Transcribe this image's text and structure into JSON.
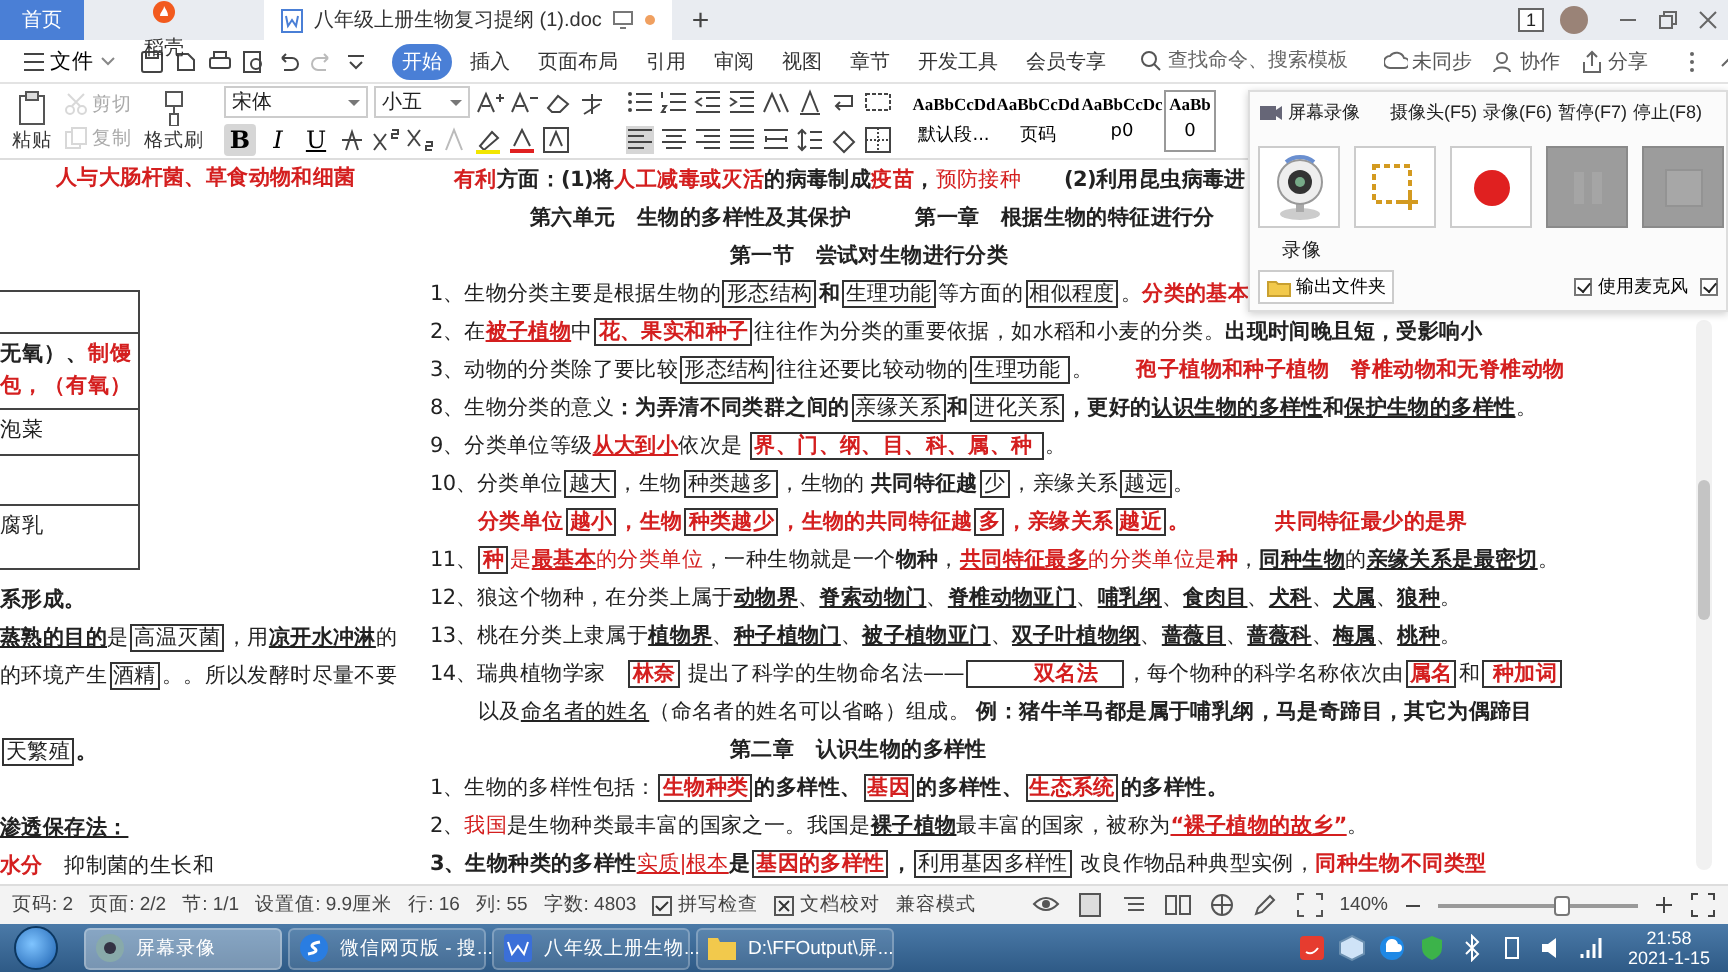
{
  "doc_tabs": [
    {
      "label": "首页",
      "kind": "home",
      "selected": false
    },
    {
      "label": "稻壳",
      "kind": "app",
      "selected": false
    },
    {
      "label": "八年级上册生物复习提纲 (1).doc",
      "kind": "doc",
      "selected": true
    }
  ],
  "new_tab_label": "+",
  "notification_badge": "1",
  "menu": {
    "file_label": "文件",
    "tabs": [
      {
        "label": "开始",
        "selected": true
      },
      {
        "label": "插入",
        "selected": false
      },
      {
        "label": "页面布局",
        "selected": false
      },
      {
        "label": "引用",
        "selected": false
      },
      {
        "label": "审阅",
        "selected": false
      },
      {
        "label": "视图",
        "selected": false
      },
      {
        "label": "章节",
        "selected": false
      },
      {
        "label": "开发工具",
        "selected": false
      },
      {
        "label": "会员专享",
        "selected": false
      }
    ],
    "search": {
      "placeholder": "查找命令、搜索模板"
    },
    "actions": [
      "未同步",
      "协作",
      "分享"
    ]
  },
  "toolbar": {
    "clipboard": [
      {
        "label": "粘贴",
        "kind": "paste",
        "disabled": false
      },
      {
        "label": "剪切",
        "kind": "cut",
        "disabled": true
      },
      {
        "label": "复制",
        "kind": "copy",
        "disabled": true
      },
      {
        "label": "格式刷",
        "kind": "painter",
        "disabled": false
      }
    ],
    "font": "宋体",
    "font_size": "小五",
    "font_buttons": [
      {
        "label": "B",
        "kind": "bold",
        "selected": true
      },
      {
        "label": "I",
        "kind": "italic",
        "selected": false
      },
      {
        "label": "U",
        "kind": "underline",
        "selected": false
      }
    ],
    "styles": [
      {
        "preview": "AaBbCcDd",
        "name": "默认段...",
        "selected": false
      },
      {
        "preview": "AaBbCcDd",
        "name": "页码",
        "selected": false
      },
      {
        "preview": "AaBbCcDc",
        "name": "p0",
        "selected": false
      },
      {
        "preview": "AaBb",
        "name": "0",
        "selected": true
      }
    ]
  },
  "recorder": {
    "title": "屏幕录像",
    "hotkeys": [
      "摄像头(F5)",
      "录像(F6)",
      "暂停(F7)",
      "停止(F8)"
    ],
    "tools": [
      {
        "kind": "webcam",
        "disabled": false
      },
      {
        "kind": "region",
        "disabled": false
      },
      {
        "kind": "record",
        "disabled": false
      },
      {
        "kind": "pause",
        "disabled": true
      },
      {
        "kind": "stop",
        "disabled": true
      }
    ],
    "mode_label": "录像",
    "folder_button": "输出文件夹",
    "checkboxes": [
      {
        "label": "使用麦克风",
        "checked": true
      },
      {
        "checked": true
      }
    ]
  },
  "document": {
    "left_page": {
      "title": [
        {
          "text": "人与大肠杆菌、草食动物和细菌",
          "kind": "redbold"
        }
      ],
      "table": {
        "rows": [
          {
            "kind": "empty"
          },
          {
            "kind": "text",
            "lines": [
              [
                {
                  "text": "无氧）、",
                  "kind": "bold"
                },
                {
                  "text": "制馒",
                  "kind": "redbold"
                }
              ],
              [
                {
                  "text": "包，（有氧）",
                  "kind": "redbold"
                }
              ]
            ]
          },
          {
            "kind": "text",
            "lines": [
              [
                {
                  "text": "泡菜",
                  "kind": "plain"
                }
              ]
            ]
          },
          {
            "kind": "empty"
          },
          {
            "kind": "text",
            "lines": [
              [
                {
                  "text": "腐乳",
                  "kind": "plain"
                }
              ]
            ]
          }
        ]
      },
      "lines": [
        {
          "kind": "line",
          "segments": [
            {
              "text": "系形成。",
              "kind": "bold"
            }
          ]
        },
        {
          "kind": "line",
          "segments": [
            {
              "text": "蒸熟的目的",
              "kind": "boldunder"
            },
            {
              "text": "是",
              "kind": "plain"
            },
            {
              "text": "高温灭菌",
              "kind": "box"
            },
            {
              "text": "，用",
              "kind": "plain"
            },
            {
              "text": "凉开水冲淋",
              "kind": "boldunder"
            },
            {
              "text": "的",
              "kind": "plain"
            }
          ]
        },
        {
          "kind": "line",
          "segments": [
            {
              "text": "的环境产生",
              "kind": "plain"
            },
            {
              "text": "酒精",
              "kind": "box"
            },
            {
              "text": "。。所以发酵时尽量不要",
              "kind": "plain"
            }
          ]
        },
        {
          "kind": "para",
          "segments": [
            {
              "text": "天繁殖",
              "kind": "box"
            },
            {
              "text": "。",
              "kind": "bold"
            }
          ]
        },
        {
          "kind": "para",
          "segments": [
            {
              "text": "渗透保存法：",
              "kind": "boldunder"
            }
          ]
        },
        {
          "kind": "line",
          "segments": [
            {
              "text": "水分",
              "kind": "redbold"
            },
            {
              "text": "　抑制菌的生长和",
              "kind": "plain"
            }
          ]
        }
      ]
    },
    "right_page": {
      "lines": [
        {
          "kind": "note",
          "segments": [
            {
              "text": "有利",
              "kind": "redbold"
            },
            {
              "text": "方面：(1)将",
              "kind": "bold"
            },
            {
              "text": "人工减毒或灭活",
              "kind": "redbold"
            },
            {
              "text": "的病毒制成",
              "kind": "bold"
            },
            {
              "text": "疫苗",
              "kind": "redbold"
            },
            {
              "text": "，",
              "kind": "bold"
            },
            {
              "text": "预防接种",
              "kind": "red"
            },
            {
              "text": "　　(2)利用昆虫病毒进",
              "kind": "bold"
            }
          ]
        },
        {
          "kind": "title",
          "segments": [
            {
              "text": "第六单元　生物的多样性及其保护　　　第一章　根据生物的特征进行分",
              "kind": "bold"
            }
          ]
        },
        {
          "kind": "heading",
          "segments": [
            {
              "text": "第一节　尝试对生物进行分类",
              "kind": "bold"
            }
          ]
        },
        {
          "kind": "item",
          "segments": [
            {
              "text": "1、生物分类主要是根据生物的",
              "kind": "plain"
            },
            {
              "text": "形态结构",
              "kind": "box"
            },
            {
              "text": "和",
              "kind": "bold"
            },
            {
              "text": "生理功能",
              "kind": "box"
            },
            {
              "text": "等方面的",
              "kind": "plain"
            },
            {
              "text": "相似程度",
              "kind": "box"
            },
            {
              "text": "。",
              "kind": "plain"
            },
            {
              "text": "分类的基本",
              "kind": "redbold"
            }
          ]
        },
        {
          "kind": "item",
          "segments": [
            {
              "text": "2、在",
              "kind": "plain"
            },
            {
              "text": "被子植物",
              "kind": "redboldunder"
            },
            {
              "text": "中",
              "kind": "plain"
            },
            {
              "text": "花、果实和种子",
              "kind": "redbox"
            },
            {
              "text": "往往作为分类的重要依据，如水稻和小麦的分类。",
              "kind": "plain"
            },
            {
              "text": "出现时间晚且短，受影响小",
              "kind": "bold"
            }
          ]
        },
        {
          "kind": "item",
          "segments": [
            {
              "text": "3、动物的分类除了要比较",
              "kind": "plain"
            },
            {
              "text": "形态结构",
              "kind": "box"
            },
            {
              "text": "往往还要比较动物的",
              "kind": "plain"
            },
            {
              "text": "生理功能 ",
              "kind": "box"
            },
            {
              "text": "。　　",
              "kind": "plain"
            },
            {
              "text": "孢子植物和种子植物　脊椎动物和无脊椎动物",
              "kind": "redbold"
            }
          ]
        },
        {
          "kind": "item",
          "segments": [
            {
              "text": "8、生物分类的意义",
              "kind": "plain"
            },
            {
              "text": "：为弄清不同类群之间的",
              "kind": "bold"
            },
            {
              "text": "亲缘关系",
              "kind": "box"
            },
            {
              "text": "和",
              "kind": "bold"
            },
            {
              "text": "进化关系",
              "kind": "box"
            },
            {
              "text": "，更好的",
              "kind": "bold"
            },
            {
              "text": "认识生物的多样性",
              "kind": "boldunder"
            },
            {
              "text": "和",
              "kind": "bold"
            },
            {
              "text": "保护生物的多样性",
              "kind": "boldunder"
            },
            {
              "text": "。",
              "kind": "plain"
            }
          ]
        },
        {
          "kind": "item",
          "segments": [
            {
              "text": "9、分类单位等级",
              "kind": "plain"
            },
            {
              "text": "从大到小",
              "kind": "redboldunder"
            },
            {
              "text": "依次是 ",
              "kind": "plain"
            },
            {
              "text": "界、门、纲、目、科、属、种 ",
              "kind": "redbox"
            },
            {
              "text": "。",
              "kind": "plain"
            }
          ]
        },
        {
          "kind": "item",
          "segments": [
            {
              "text": "10、分类单位",
              "kind": "plain"
            },
            {
              "text": "越大",
              "kind": "box"
            },
            {
              "text": "，生物",
              "kind": "plain"
            },
            {
              "text": "种类越多",
              "kind": "box"
            },
            {
              "text": "，生物的 ",
              "kind": "plain"
            },
            {
              "text": "共同特征越",
              "kind": "bold"
            },
            {
              "text": "少",
              "kind": "box"
            },
            {
              "text": "，亲缘关系",
              "kind": "plain"
            },
            {
              "text": "越远",
              "kind": "box"
            },
            {
              "text": "。",
              "kind": "plain"
            }
          ]
        },
        {
          "kind": "indent",
          "segments": [
            {
              "text": "分类单位",
              "kind": "redbold"
            },
            {
              "text": "越小",
              "kind": "redbox"
            },
            {
              "text": "，生物",
              "kind": "redbold"
            },
            {
              "text": "种类越少",
              "kind": "redbox"
            },
            {
              "text": "，生物的共同特征越",
              "kind": "redbold"
            },
            {
              "text": "多",
              "kind": "redbox"
            },
            {
              "text": "，亲缘关系",
              "kind": "redbold"
            },
            {
              "text": "越近",
              "kind": "redbox"
            },
            {
              "text": "。　　　　共同特征最少的是界",
              "kind": "redbold"
            }
          ]
        },
        {
          "kind": "item",
          "segments": [
            {
              "text": "11、",
              "kind": "plain"
            },
            {
              "text": "种",
              "kind": "redbox"
            },
            {
              "text": "是",
              "kind": "red"
            },
            {
              "text": "最基本",
              "kind": "redboldunder"
            },
            {
              "text": "的分类单位",
              "kind": "red"
            },
            {
              "text": "，一种生物就是一个",
              "kind": "plain"
            },
            {
              "text": "物种",
              "kind": "bold"
            },
            {
              "text": "，",
              "kind": "plain"
            },
            {
              "text": "共同特征最多",
              "kind": "redboldunder"
            },
            {
              "text": "的分类单位是",
              "kind": "red"
            },
            {
              "text": "种",
              "kind": "redbold"
            },
            {
              "text": "，",
              "kind": "plain"
            },
            {
              "text": "同种生物",
              "kind": "boldunder"
            },
            {
              "text": "的",
              "kind": "plain"
            },
            {
              "text": "亲缘关系是最密切",
              "kind": "boldunder"
            },
            {
              "text": "。",
              "kind": "plain"
            }
          ]
        },
        {
          "kind": "item",
          "segments": [
            {
              "text": "12、狼这个物种，在分类上属于",
              "kind": "plain"
            },
            {
              "text": "动物界",
              "kind": "boldunder"
            },
            {
              "text": "、",
              "kind": "plain"
            },
            {
              "text": "脊索动物门",
              "kind": "boldunder"
            },
            {
              "text": "、",
              "kind": "plain"
            },
            {
              "text": "脊椎动物亚门",
              "kind": "boldunder"
            },
            {
              "text": "、",
              "kind": "plain"
            },
            {
              "text": "哺乳纲",
              "kind": "boldunder"
            },
            {
              "text": "、",
              "kind": "plain"
            },
            {
              "text": "食肉目",
              "kind": "boldunder"
            },
            {
              "text": "、",
              "kind": "plain"
            },
            {
              "text": "犬科",
              "kind": "boldunder"
            },
            {
              "text": "、",
              "kind": "plain"
            },
            {
              "text": "犬属",
              "kind": "boldunder"
            },
            {
              "text": "、",
              "kind": "plain"
            },
            {
              "text": "狼种",
              "kind": "boldunder"
            },
            {
              "text": "。",
              "kind": "plain"
            }
          ]
        },
        {
          "kind": "item",
          "segments": [
            {
              "text": "13、桃在分类上隶属于",
              "kind": "plain"
            },
            {
              "text": "植物界",
              "kind": "boldunder"
            },
            {
              "text": "、",
              "kind": "plain"
            },
            {
              "text": "种子植物门",
              "kind": "boldunder"
            },
            {
              "text": "、",
              "kind": "plain"
            },
            {
              "text": "被子植物亚门",
              "kind": "boldunder"
            },
            {
              "text": "、",
              "kind": "plain"
            },
            {
              "text": "双子叶植物纲",
              "kind": "boldunder"
            },
            {
              "text": "、",
              "kind": "plain"
            },
            {
              "text": "蔷薇目",
              "kind": "boldunder"
            },
            {
              "text": "、",
              "kind": "plain"
            },
            {
              "text": "蔷薇科",
              "kind": "boldunder"
            },
            {
              "text": "、",
              "kind": "plain"
            },
            {
              "text": "梅属",
              "kind": "boldunder"
            },
            {
              "text": "、",
              "kind": "plain"
            },
            {
              "text": "桃种",
              "kind": "boldunder"
            },
            {
              "text": "。",
              "kind": "plain"
            }
          ]
        },
        {
          "kind": "item",
          "segments": [
            {
              "text": "14、瑞典植物学家　",
              "kind": "plain"
            },
            {
              "text": "林奈",
              "kind": "redbox"
            },
            {
              "text": " 提出了科学的生物命名法——",
              "kind": "plain"
            },
            {
              "text": "　　　双名法　",
              "kind": "redbox"
            },
            {
              "text": "，每个物种的科学名称依次由",
              "kind": "plain"
            },
            {
              "text": "属名",
              "kind": "redbox"
            },
            {
              "text": "和",
              "kind": "plain"
            },
            {
              "text": " 种加词",
              "kind": "redbox"
            }
          ]
        },
        {
          "kind": "indent",
          "segments": [
            {
              "text": "以及",
              "kind": "plain"
            },
            {
              "text": "命名者的姓名",
              "kind": "under"
            },
            {
              "text": "（命名者的姓名可以省略）组成。 ",
              "kind": "plain"
            },
            {
              "text": "例：猪牛羊马都是属于哺乳纲，马是奇蹄目，其它为偶蹄目",
              "kind": "bold"
            }
          ]
        },
        {
          "kind": "heading",
          "segments": [
            {
              "text": "第二章　认识生物的多样性",
              "kind": "bold"
            }
          ]
        },
        {
          "kind": "item",
          "segments": [
            {
              "text": "1、生物的多样性包括：",
              "kind": "plain"
            },
            {
              "text": "生物种类",
              "kind": "redbox"
            },
            {
              "text": "的多样性、",
              "kind": "bold"
            },
            {
              "text": "基因",
              "kind": "redbox"
            },
            {
              "text": "的多样性、",
              "kind": "bold"
            },
            {
              "text": "生态系统",
              "kind": "redbox"
            },
            {
              "text": "的多样性。",
              "kind": "bold"
            }
          ]
        },
        {
          "kind": "item",
          "segments": [
            {
              "text": "2、",
              "kind": "plain"
            },
            {
              "text": "我国",
              "kind": "red"
            },
            {
              "text": "是生物种类最丰富的国家之一。我国是",
              "kind": "plain"
            },
            {
              "text": "裸子植物",
              "kind": "boldunder"
            },
            {
              "text": "最丰富的国家，被称为",
              "kind": "plain"
            },
            {
              "text": "“裸子植物的故乡”",
              "kind": "redboldunder"
            },
            {
              "text": "。",
              "kind": "plain"
            }
          ]
        },
        {
          "kind": "item",
          "segments": [
            {
              "text": "3、生物种类的多样性",
              "kind": "bold"
            },
            {
              "text": "实质|根本",
              "kind": "redunder"
            },
            {
              "text": "是",
              "kind": "bold"
            },
            {
              "text": "基因的多样性",
              "kind": "redbox"
            },
            {
              "text": "，",
              "kind": "bold"
            },
            {
              "text": "利用基因多样性",
              "kind": "box"
            },
            {
              "text": " 改良作物品种典型实例，",
              "kind": "plain"
            },
            {
              "text": "同种生物不同类型",
              "kind": "redbold"
            }
          ]
        }
      ]
    }
  },
  "status_bar": {
    "items": [
      "页码: 2",
      "页面: 2/2",
      "节: 1/1",
      "设置值: 9.9厘米",
      "行: 16",
      "列: 55",
      "字数: 4803"
    ],
    "checks": [
      {
        "label": "拼写检查",
        "kind": "check"
      },
      {
        "label": "文档校对",
        "kind": "cross"
      }
    ],
    "mode": "兼容模式",
    "zoom": "140%",
    "zoom_slider": {
      "level": 0.62
    }
  },
  "taskbar": {
    "items": [
      {
        "label": "屏幕录像",
        "kind": "recorder",
        "selected": true
      },
      {
        "label": "微信网页版 - 搜...",
        "kind": "browser",
        "selected": false
      },
      {
        "label": "八年级上册生物...",
        "kind": "wps",
        "selected": false
      },
      {
        "label": "D:\\FFOutput\\屏...",
        "kind": "folder",
        "selected": false
      }
    ],
    "time": "21:58",
    "date": "2021-1-15"
  }
}
